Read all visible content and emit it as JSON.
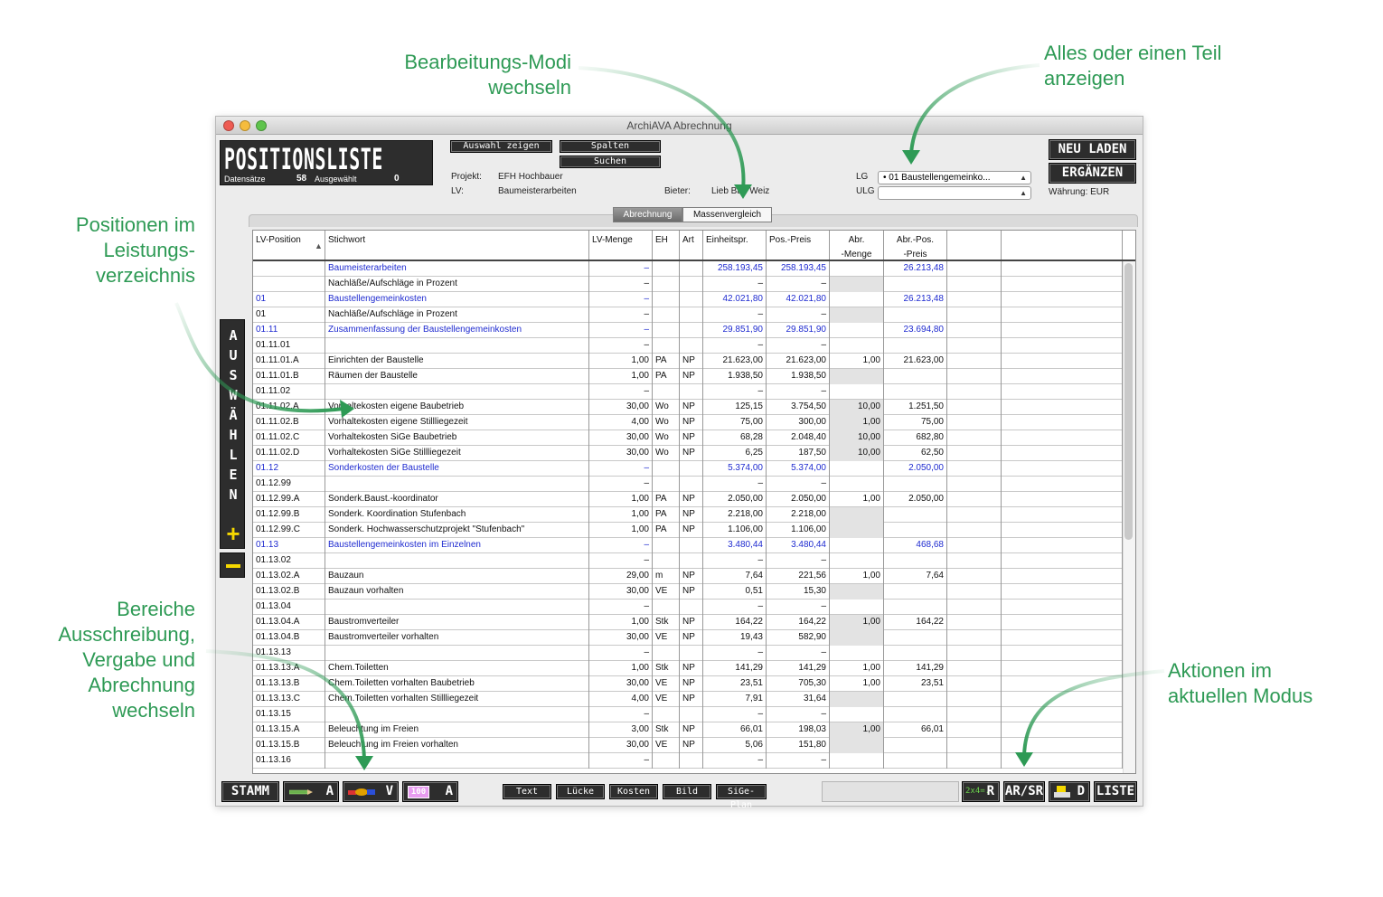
{
  "annotations": {
    "modi": [
      "Bearbeitungs-Modi",
      "wechseln"
    ],
    "teil": [
      "Alles oder einen Teil",
      "anzeigen"
    ],
    "positionen": [
      "Positionen im",
      "Leistungs-",
      "verzeichnis"
    ],
    "bereiche": [
      "Bereiche",
      "Ausschreibung,",
      "Vergabe und",
      "Abrechnung",
      "wechseln"
    ],
    "aktionen": [
      "Aktionen im",
      "aktuellen Modus"
    ]
  },
  "window": {
    "title": "ArchiAVA Abrechnung"
  },
  "header": {
    "title": "POSITIONSLISTE",
    "datensaetze_label": "Datensätze",
    "datensaetze_count": "58",
    "ausgewaehlt_label": "Ausgewählt",
    "ausgewaehlt_count": "0"
  },
  "toolbar": {
    "auswahl_zeigen": "Auswahl zeigen",
    "spalten": "Spalten",
    "suchen": "Suchen"
  },
  "project": {
    "projekt_label": "Projekt:",
    "projekt_value": "EFH Hochbauer",
    "lv_label": "LV:",
    "lv_value": "Baumeisterarbeiten",
    "bieter_label": "Bieter:",
    "bieter_value": "Lieb Bau Weiz"
  },
  "filters": {
    "lg_label": "LG",
    "lg_value": "• 01  Baustellengemeinko...",
    "ulg_label": "ULG",
    "ulg_value": ""
  },
  "actions": {
    "neu_laden": "NEU LADEN",
    "ergaenzen": "ERGÄNZEN",
    "waehrung": "Währung:  EUR"
  },
  "tabs": {
    "abrechnung": "Abrechnung",
    "massenvergleich": "Massenvergleich"
  },
  "table": {
    "columns": [
      {
        "key": "pos",
        "label": "LV-Position"
      },
      {
        "key": "stich",
        "label": "Stichwort"
      },
      {
        "key": "menge",
        "label": "LV-Menge"
      },
      {
        "key": "eh",
        "label": "EH"
      },
      {
        "key": "art",
        "label": "Art"
      },
      {
        "key": "ep",
        "label": "Einheitspr."
      },
      {
        "key": "pp",
        "label": "Pos.-Preis"
      },
      {
        "key": "am",
        "label": "Abr.\n-Menge"
      },
      {
        "key": "ap",
        "label": "Abr.-Pos.\n-Preis"
      }
    ],
    "rows": [
      {
        "pos": "",
        "stich": "Baumeisterarbeiten",
        "menge": "–",
        "eh": "",
        "art": "",
        "ep": "258.193,45",
        "pp": "258.193,45",
        "am": "",
        "ap": "26.213,48",
        "blue": true,
        "shade": false
      },
      {
        "pos": "",
        "stich": "Nachläße/Aufschläge in Prozent",
        "menge": "–",
        "eh": "",
        "art": "",
        "ep": "–",
        "pp": "–",
        "am": "",
        "ap": "",
        "blue": false,
        "shade": true
      },
      {
        "pos": "01",
        "stich": "Baustellengemeinkosten",
        "menge": "–",
        "eh": "",
        "art": "",
        "ep": "42.021,80",
        "pp": "42.021,80",
        "am": "",
        "ap": "26.213,48",
        "blue": true,
        "shade": false
      },
      {
        "pos": "01",
        "stich": "Nachläße/Aufschläge in Prozent",
        "menge": "–",
        "eh": "",
        "art": "",
        "ep": "–",
        "pp": "–",
        "am": "",
        "ap": "",
        "blue": false,
        "shade": true
      },
      {
        "pos": "01.11",
        "stich": "Zusammenfassung der Baustellengemeinkosten",
        "menge": "–",
        "eh": "",
        "art": "",
        "ep": "29.851,90",
        "pp": "29.851,90",
        "am": "",
        "ap": "23.694,80",
        "blue": true,
        "shade": false
      },
      {
        "pos": "01.11.01",
        "stich": "",
        "menge": "–",
        "eh": "",
        "art": "",
        "ep": "–",
        "pp": "–",
        "am": "",
        "ap": "",
        "blue": false,
        "shade": false
      },
      {
        "pos": "01.11.01.A",
        "stich": "Einrichten der Baustelle",
        "menge": "1,00",
        "eh": "PA",
        "art": "NP",
        "ep": "21.623,00",
        "pp": "21.623,00",
        "am": "1,00",
        "ap": "21.623,00",
        "blue": false,
        "shade": false
      },
      {
        "pos": "01.11.01.B",
        "stich": "Räumen der Baustelle",
        "menge": "1,00",
        "eh": "PA",
        "art": "NP",
        "ep": "1.938,50",
        "pp": "1.938,50",
        "am": "",
        "ap": "",
        "blue": false,
        "shade": true
      },
      {
        "pos": "01.11.02",
        "stich": "",
        "menge": "–",
        "eh": "",
        "art": "",
        "ep": "–",
        "pp": "–",
        "am": "",
        "ap": "",
        "blue": false,
        "shade": false
      },
      {
        "pos": "01.11.02.A",
        "stich": "Vorhaltekosten eigene Baubetrieb",
        "menge": "30,00",
        "eh": "Wo",
        "art": "NP",
        "ep": "125,15",
        "pp": "3.754,50",
        "am": "10,00",
        "ap": "1.251,50",
        "blue": false,
        "shade": true
      },
      {
        "pos": "01.11.02.B",
        "stich": "Vorhaltekosten eigene Stillliegezeit",
        "menge": "4,00",
        "eh": "Wo",
        "art": "NP",
        "ep": "75,00",
        "pp": "300,00",
        "am": "1,00",
        "ap": "75,00",
        "blue": false,
        "shade": true
      },
      {
        "pos": "01.11.02.C",
        "stich": "Vorhaltekosten SiGe Baubetrieb",
        "menge": "30,00",
        "eh": "Wo",
        "art": "NP",
        "ep": "68,28",
        "pp": "2.048,40",
        "am": "10,00",
        "ap": "682,80",
        "blue": false,
        "shade": true
      },
      {
        "pos": "01.11.02.D",
        "stich": "Vorhaltekosten SiGe Stillliegezeit",
        "menge": "30,00",
        "eh": "Wo",
        "art": "NP",
        "ep": "6,25",
        "pp": "187,50",
        "am": "10,00",
        "ap": "62,50",
        "blue": false,
        "shade": true
      },
      {
        "pos": "01.12",
        "stich": "Sonderkosten der Baustelle",
        "menge": "–",
        "eh": "",
        "art": "",
        "ep": "5.374,00",
        "pp": "5.374,00",
        "am": "",
        "ap": "2.050,00",
        "blue": true,
        "shade": false
      },
      {
        "pos": "01.12.99",
        "stich": "",
        "menge": "–",
        "eh": "",
        "art": "",
        "ep": "–",
        "pp": "–",
        "am": "",
        "ap": "",
        "blue": false,
        "shade": false
      },
      {
        "pos": "01.12.99.A",
        "stich": "Sonderk.Baust.-koordinator",
        "menge": "1,00",
        "eh": "PA",
        "art": "NP",
        "ep": "2.050,00",
        "pp": "2.050,00",
        "am": "1,00",
        "ap": "2.050,00",
        "blue": false,
        "shade": false
      },
      {
        "pos": "01.12.99.B",
        "stich": "Sonderk. Koordination Stufenbach",
        "menge": "1,00",
        "eh": "PA",
        "art": "NP",
        "ep": "2.218,00",
        "pp": "2.218,00",
        "am": "",
        "ap": "",
        "blue": false,
        "shade": true
      },
      {
        "pos": "01.12.99.C",
        "stich": "Sonderk. Hochwasserschutzprojekt \"Stufenbach\"",
        "menge": "1,00",
        "eh": "PA",
        "art": "NP",
        "ep": "1.106,00",
        "pp": "1.106,00",
        "am": "",
        "ap": "",
        "blue": false,
        "shade": true
      },
      {
        "pos": "01.13",
        "stich": "Baustellengemeinkosten im Einzelnen",
        "menge": "–",
        "eh": "",
        "art": "",
        "ep": "3.480,44",
        "pp": "3.480,44",
        "am": "",
        "ap": "468,68",
        "blue": true,
        "shade": false
      },
      {
        "pos": "01.13.02",
        "stich": "",
        "menge": "–",
        "eh": "",
        "art": "",
        "ep": "–",
        "pp": "–",
        "am": "",
        "ap": "",
        "blue": false,
        "shade": false
      },
      {
        "pos": "01.13.02.A",
        "stich": "Bauzaun",
        "menge": "29,00",
        "eh": "m",
        "art": "NP",
        "ep": "7,64",
        "pp": "221,56",
        "am": "1,00",
        "ap": "7,64",
        "blue": false,
        "shade": false
      },
      {
        "pos": "01.13.02.B",
        "stich": "Bauzaun vorhalten",
        "menge": "30,00",
        "eh": "VE",
        "art": "NP",
        "ep": "0,51",
        "pp": "15,30",
        "am": "",
        "ap": "",
        "blue": false,
        "shade": true
      },
      {
        "pos": "01.13.04",
        "stich": "",
        "menge": "–",
        "eh": "",
        "art": "",
        "ep": "–",
        "pp": "–",
        "am": "",
        "ap": "",
        "blue": false,
        "shade": false
      },
      {
        "pos": "01.13.04.A",
        "stich": "Baustromverteiler",
        "menge": "1,00",
        "eh": "Stk",
        "art": "NP",
        "ep": "164,22",
        "pp": "164,22",
        "am": "1,00",
        "ap": "164,22",
        "blue": false,
        "shade": true
      },
      {
        "pos": "01.13.04.B",
        "stich": "Baustromverteiler vorhalten",
        "menge": "30,00",
        "eh": "VE",
        "art": "NP",
        "ep": "19,43",
        "pp": "582,90",
        "am": "",
        "ap": "",
        "blue": false,
        "shade": true
      },
      {
        "pos": "01.13.13",
        "stich": "",
        "menge": "–",
        "eh": "",
        "art": "",
        "ep": "–",
        "pp": "–",
        "am": "",
        "ap": "",
        "blue": false,
        "shade": false
      },
      {
        "pos": "01.13.13.A",
        "stich": "Chem.Toiletten",
        "menge": "1,00",
        "eh": "Stk",
        "art": "NP",
        "ep": "141,29",
        "pp": "141,29",
        "am": "1,00",
        "ap": "141,29",
        "blue": false,
        "shade": false
      },
      {
        "pos": "01.13.13.B",
        "stich": "Chem.Toiletten vorhalten Baubetrieb",
        "menge": "30,00",
        "eh": "VE",
        "art": "NP",
        "ep": "23,51",
        "pp": "705,30",
        "am": "1,00",
        "ap": "23,51",
        "blue": false,
        "shade": false
      },
      {
        "pos": "01.13.13.C",
        "stich": "Chem.Toiletten vorhalten Stillliegezeit",
        "menge": "4,00",
        "eh": "VE",
        "art": "NP",
        "ep": "7,91",
        "pp": "31,64",
        "am": "",
        "ap": "",
        "blue": false,
        "shade": true
      },
      {
        "pos": "01.13.15",
        "stich": "",
        "menge": "–",
        "eh": "",
        "art": "",
        "ep": "–",
        "pp": "–",
        "am": "",
        "ap": "",
        "blue": false,
        "shade": false
      },
      {
        "pos": "01.13.15.A",
        "stich": "Beleuchtung im Freien",
        "menge": "3,00",
        "eh": "Stk",
        "art": "NP",
        "ep": "66,01",
        "pp": "198,03",
        "am": "1,00",
        "ap": "66,01",
        "blue": false,
        "shade": true
      },
      {
        "pos": "01.13.15.B",
        "stich": "Beleuchtung im Freien vorhalten",
        "menge": "30,00",
        "eh": "VE",
        "art": "NP",
        "ep": "5,06",
        "pp": "151,80",
        "am": "",
        "ap": "",
        "blue": false,
        "shade": true
      },
      {
        "pos": "01.13.16",
        "stich": "",
        "menge": "–",
        "eh": "",
        "art": "",
        "ep": "–",
        "pp": "–",
        "am": "",
        "ap": "",
        "blue": false,
        "shade": false
      }
    ]
  },
  "sidebar": {
    "auswaehlen_letters": [
      "A",
      "U",
      "S",
      "W",
      "Ä",
      "H",
      "L",
      "E",
      "N"
    ],
    "plus": "+"
  },
  "bottom": {
    "stamm": "STAMM",
    "a_label": "A",
    "v_label": "V",
    "a2_label": "A",
    "hundred": "100",
    "text": "Text",
    "luecke": "Lücke",
    "kosten": "Kosten",
    "bild": "Bild",
    "sige": "SiGe-Plan",
    "r_icon_text": "2x4=.",
    "r_label": "R",
    "arsr": "AR/SR",
    "d_label": "D",
    "liste": "LISTE"
  },
  "colors": {
    "annotation": "#2e9a55",
    "blue_row": "#1f2bd0",
    "dark_button": "#2d2d2d",
    "accent_yellow": "#f5d800"
  }
}
